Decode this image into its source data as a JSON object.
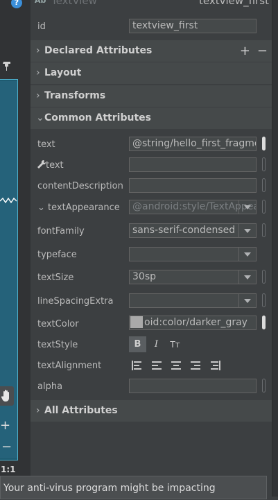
{
  "header": {
    "badge": "Ab",
    "component_type": "TextView",
    "component_id": "textview_first"
  },
  "id_row": {
    "label": "id",
    "value": "textview_first"
  },
  "sections": {
    "declared": "Declared Attributes",
    "layout": "Layout",
    "transforms": "Transforms",
    "common": "Common Attributes",
    "all": "All Attributes"
  },
  "declared_actions": {
    "add": "+",
    "remove": "−"
  },
  "attributes": {
    "text": {
      "label": "text",
      "value": "@string/hello_first_fragment"
    },
    "tools_text": {
      "label": "text",
      "value": ""
    },
    "content_description": {
      "label": "contentDescription",
      "value": ""
    },
    "text_appearance": {
      "label": "textAppearance",
      "value": "@android:style/TextAppearance"
    },
    "font_family": {
      "label": "fontFamily",
      "value": "sans-serif-condensed"
    },
    "typeface": {
      "label": "typeface",
      "value": ""
    },
    "text_size": {
      "label": "textSize",
      "value": "30sp"
    },
    "line_spacing_extra": {
      "label": "lineSpacingExtra",
      "value": ""
    },
    "text_color": {
      "label": "textColor",
      "value": "oid:color/darker_gray",
      "swatch": "#a9a9a9"
    },
    "text_style": {
      "label": "textStyle",
      "bold": "B",
      "italic": "I",
      "caps": "Tт"
    },
    "text_alignment": {
      "label": "textAlignment"
    },
    "alpha": {
      "label": "alpha",
      "value": ""
    }
  },
  "left_toolbar": {
    "help": "?",
    "ratio": "1:1"
  },
  "toast": {
    "message": "Your anti-virus program might be impacting"
  },
  "colors": {
    "background": "#3c3f41",
    "section": "#45494a",
    "field": "#45494a",
    "canvas": "#1e5a70",
    "accent": "#4fb0cc"
  }
}
